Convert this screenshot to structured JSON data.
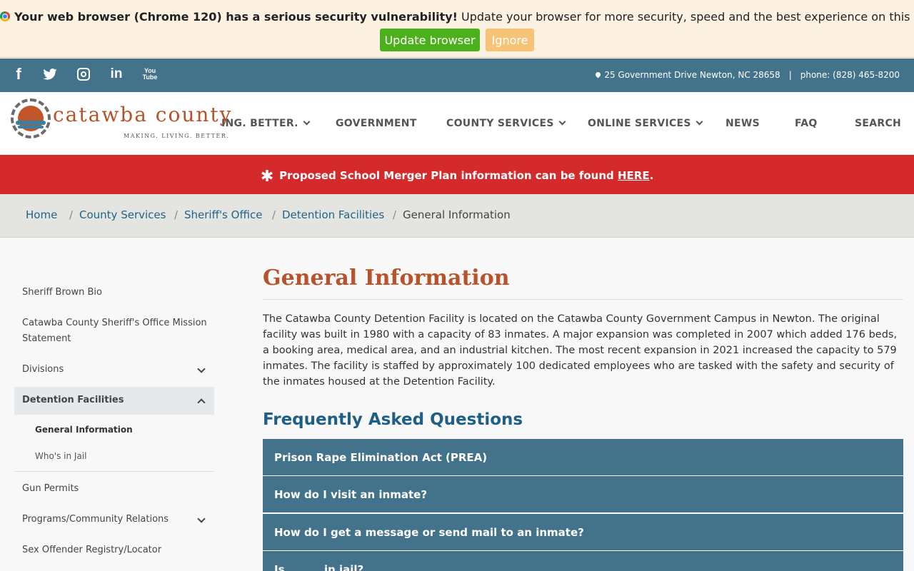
{
  "warning": {
    "bold_text": "Your web browser (Chrome 120) has a serious security vulnerability!",
    "text": " Update your browser for more security, speed and the best experience on this site.",
    "update_label": "Update browser",
    "ignore_label": "Ignore"
  },
  "topbar": {
    "address": "25 Government Drive Newton, NC 28658",
    "separator": "|",
    "phone": "phone: (828) 465-8200",
    "social": {
      "facebook": "f",
      "linkedin": "in",
      "youtube_top": "You",
      "youtube_bottom": "Tube"
    }
  },
  "header": {
    "logo_name": "catawba county",
    "logo_tagline": "MAKING. LIVING. BETTER.",
    "nav": [
      {
        "label": "ING. BETTER."
      },
      {
        "label": "GOVERNMENT"
      },
      {
        "label": "COUNTY SERVICES"
      },
      {
        "label": "ONLINE SERVICES"
      },
      {
        "label": "NEWS"
      },
      {
        "label": "FAQ"
      },
      {
        "label": "SEARCH"
      }
    ]
  },
  "alert": {
    "icon": "✱",
    "text": "Proposed School Merger Plan information can be found ",
    "link": "HERE",
    "end": "."
  },
  "breadcrumb": {
    "items": [
      "Home",
      "County Services",
      "Sheriff's Office",
      "Detention Facilities",
      "General Information"
    ],
    "separator": "/"
  },
  "sidebar": {
    "items": [
      {
        "label": "Sheriff Brown Bio"
      },
      {
        "label": "Catawba County Sheriff's Office Mission Statement"
      },
      {
        "label": "Divisions"
      },
      {
        "label": "Detention Facilities"
      },
      {
        "label": "Gun Permits"
      },
      {
        "label": "Programs/Community Relations"
      },
      {
        "label": "Sex Offender Registry/Locator"
      }
    ],
    "sub_items": [
      {
        "label": "General Information"
      },
      {
        "label": "Who's in Jail"
      }
    ]
  },
  "main": {
    "title": "General Information",
    "intro": "The Catawba County Detention Facility is located on the Catawba County Government Campus in Newton. The original facility was built in 1980 with a capacity of 83 inmates. A major expansion was completed in 2007 which added 176 beds, a booking area, medical area, and an industrial kitchen. The most recent expansion in 2021 increased the capacity to 579 inmates. The facility is staffed by approximately 100 dedicated employees who are tasked with the safety and security of the inmates housed at the Detention Facility.",
    "faq_title": "Frequently Asked Questions",
    "faq": [
      {
        "question": "Prison Rape Elimination Act (PREA)"
      },
      {
        "question": "How do I visit an inmate?"
      },
      {
        "question": "How do I get a message or send mail to an inmate?"
      },
      {
        "question": "Is ______ in jail?"
      }
    ]
  },
  "colors": {
    "topbar": "#43738a",
    "accent_orange": "#b8522a",
    "alert_red": "#d42a2b",
    "link_blue": "#22638a",
    "update_green": "#4caf1c",
    "ignore_yellow": "#f5c476"
  }
}
